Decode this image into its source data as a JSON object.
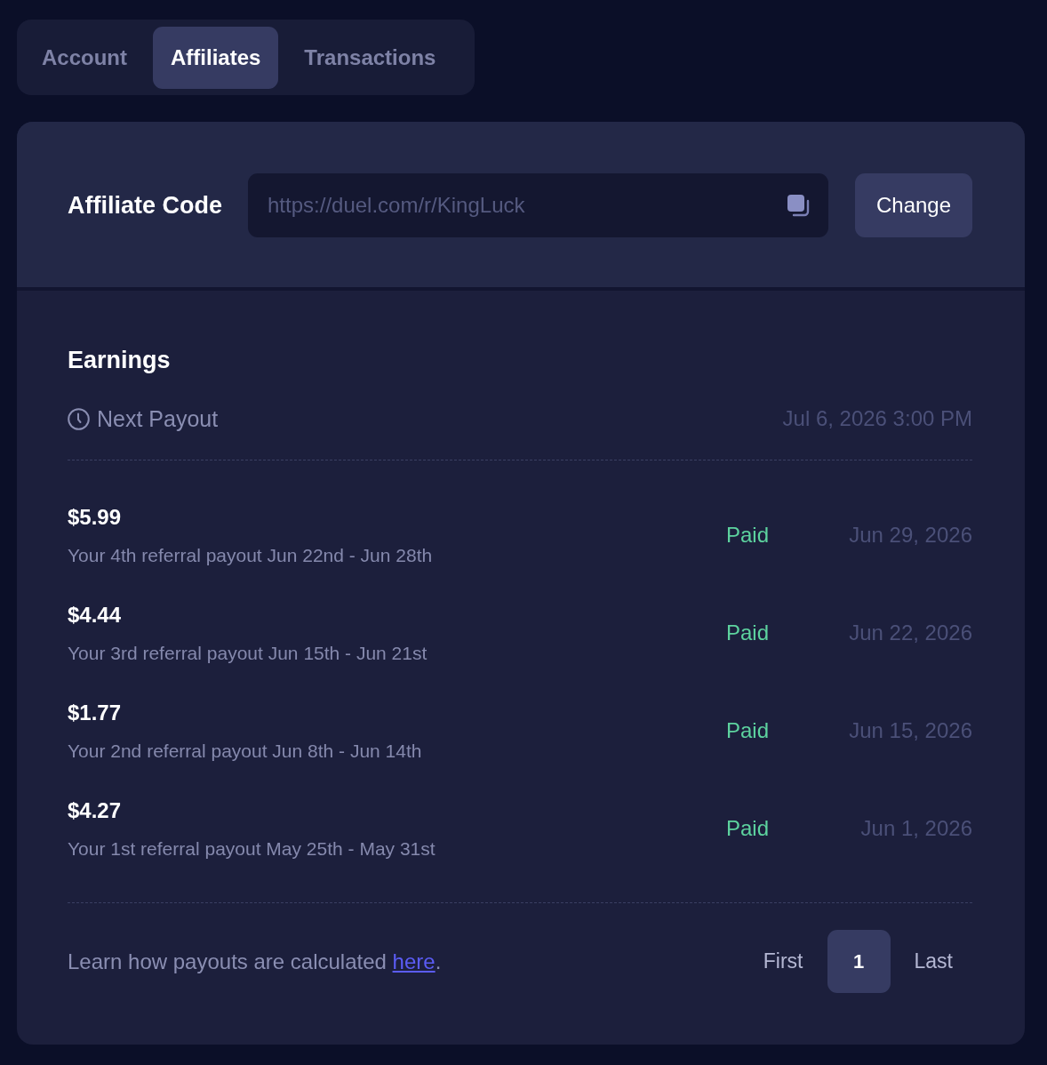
{
  "tabs": [
    {
      "label": "Account",
      "selected": false
    },
    {
      "label": "Affiliates",
      "selected": true
    },
    {
      "label": "Transactions",
      "selected": false
    }
  ],
  "affiliate_code": {
    "label": "Affiliate Code",
    "value": "https://duel.com/r/KingLuck",
    "button": "Change"
  },
  "earnings": {
    "title": "Earnings",
    "next_payout": {
      "label": "Next Payout",
      "date": "Jul 6, 2026 3:00 PM"
    },
    "payouts": [
      {
        "amount": "$5.99",
        "description": "Your 4th referral payout Jun 22nd - Jun 28th",
        "status": "Paid",
        "date": "Jun 29, 2026"
      },
      {
        "amount": "$4.44",
        "description": "Your 3rd referral payout Jun 15th - Jun 21st",
        "status": "Paid",
        "date": "Jun 22, 2026"
      },
      {
        "amount": "$1.77",
        "description": "Your 2nd referral payout Jun 8th - Jun 14th",
        "status": "Paid",
        "date": "Jun 15, 2026"
      },
      {
        "amount": "$4.27",
        "description": "Your 1st referral payout May 25th - May 31st",
        "status": "Paid",
        "date": "Jun 1, 2026"
      }
    ]
  },
  "footer": {
    "text": "Learn how payouts are calculated",
    "link": "here",
    "after": "."
  },
  "pagination": {
    "first": "First",
    "pages": [
      {
        "label": "1",
        "selected": true
      }
    ],
    "last": "Last"
  }
}
